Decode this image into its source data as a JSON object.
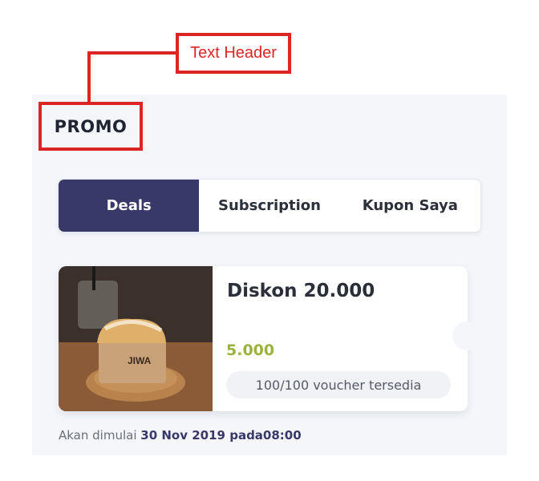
{
  "annotation": {
    "label": "Text Header"
  },
  "header": {
    "title": "PROMO"
  },
  "tabs": [
    {
      "label": "Deals",
      "active": true
    },
    {
      "label": "Subscription",
      "active": false
    },
    {
      "label": "Kupon Saya",
      "active": false
    }
  ],
  "voucher": {
    "title": "Diskon 20.000",
    "price": "5.000",
    "stock": "100/100 voucher tersedia",
    "image_brand_text": "JIWA",
    "start_prefix": "Akan dimulai",
    "start_datetime": "30 Nov 2019 pada08:00"
  },
  "colors": {
    "accent": "#383968",
    "price": "#9ab33a",
    "annotation": "#dc2626",
    "background": "#f4f6fa"
  }
}
